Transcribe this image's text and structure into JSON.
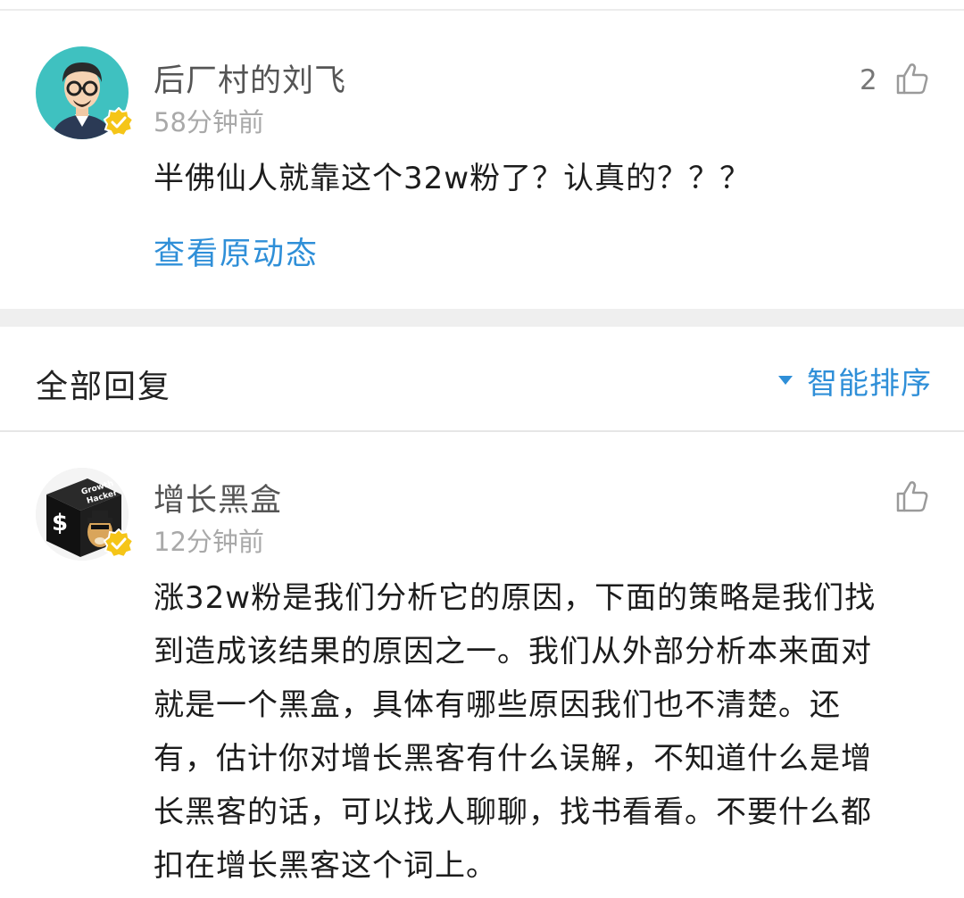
{
  "post": {
    "author": "后厂村的刘飞",
    "time": "58分钟前",
    "likes": "2",
    "content": "半佛仙人就靠这个32w粉了？认真的？？？",
    "view_original": "查看原动态"
  },
  "replies_section": {
    "title": "全部回复",
    "sort_label": "智能排序",
    "sort_icon": "triangle-down-icon"
  },
  "reply": {
    "author": "增长黑盒",
    "time": "12分钟前",
    "avatar_text": [
      "Growth",
      "Hacker",
      "$"
    ],
    "content_lines": [
      "涨32w粉是我们分析它的原因，下面的策略是我们找",
      "到造成该结果的原因之一。我们从外部分析本来面对",
      "就是一个黑盒，具体有哪些原因我们也不清楚。还",
      "有，估计你对增长黑客有什么误解，不知道什么是增",
      "长黑客的话，可以找人聊聊，找书看看。不要什么都",
      "扣在增长黑客这个词上。"
    ]
  },
  "colors": {
    "link": "#2f8fd8",
    "verified_badge": "#f5c518",
    "avatar_bg_post": "#3fc1c0"
  }
}
